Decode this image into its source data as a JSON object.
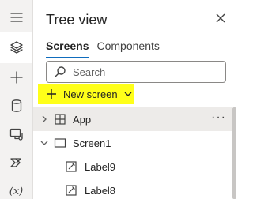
{
  "panel": {
    "title": "Tree view",
    "tabs": [
      {
        "label": "Screens",
        "active": true
      },
      {
        "label": "Components",
        "active": false
      }
    ]
  },
  "search": {
    "placeholder": "Search",
    "value": ""
  },
  "new_screen": {
    "label": "New screen",
    "highlight_color": "#ffff19"
  },
  "tree": {
    "items": [
      {
        "label": "App",
        "icon": "app-icon",
        "expanded": false,
        "selected": true
      },
      {
        "label": "Screen1",
        "icon": "screen-icon",
        "expanded": true
      },
      {
        "label": "Label9",
        "icon": "label-icon"
      },
      {
        "label": "Label8",
        "icon": "label-icon"
      }
    ]
  },
  "rail": {
    "items": [
      {
        "icon": "hamburger-icon"
      },
      {
        "icon": "layers-icon",
        "active": true
      },
      {
        "icon": "insert-plus-icon"
      },
      {
        "icon": "data-icon"
      },
      {
        "icon": "media-icon"
      },
      {
        "icon": "power-automate-icon"
      },
      {
        "icon": "variables-icon",
        "label": "(x)"
      }
    ]
  },
  "colors": {
    "accent": "#0f6cbd",
    "rail_bg": "#f3f2f1",
    "selected_row": "#edebe9"
  }
}
